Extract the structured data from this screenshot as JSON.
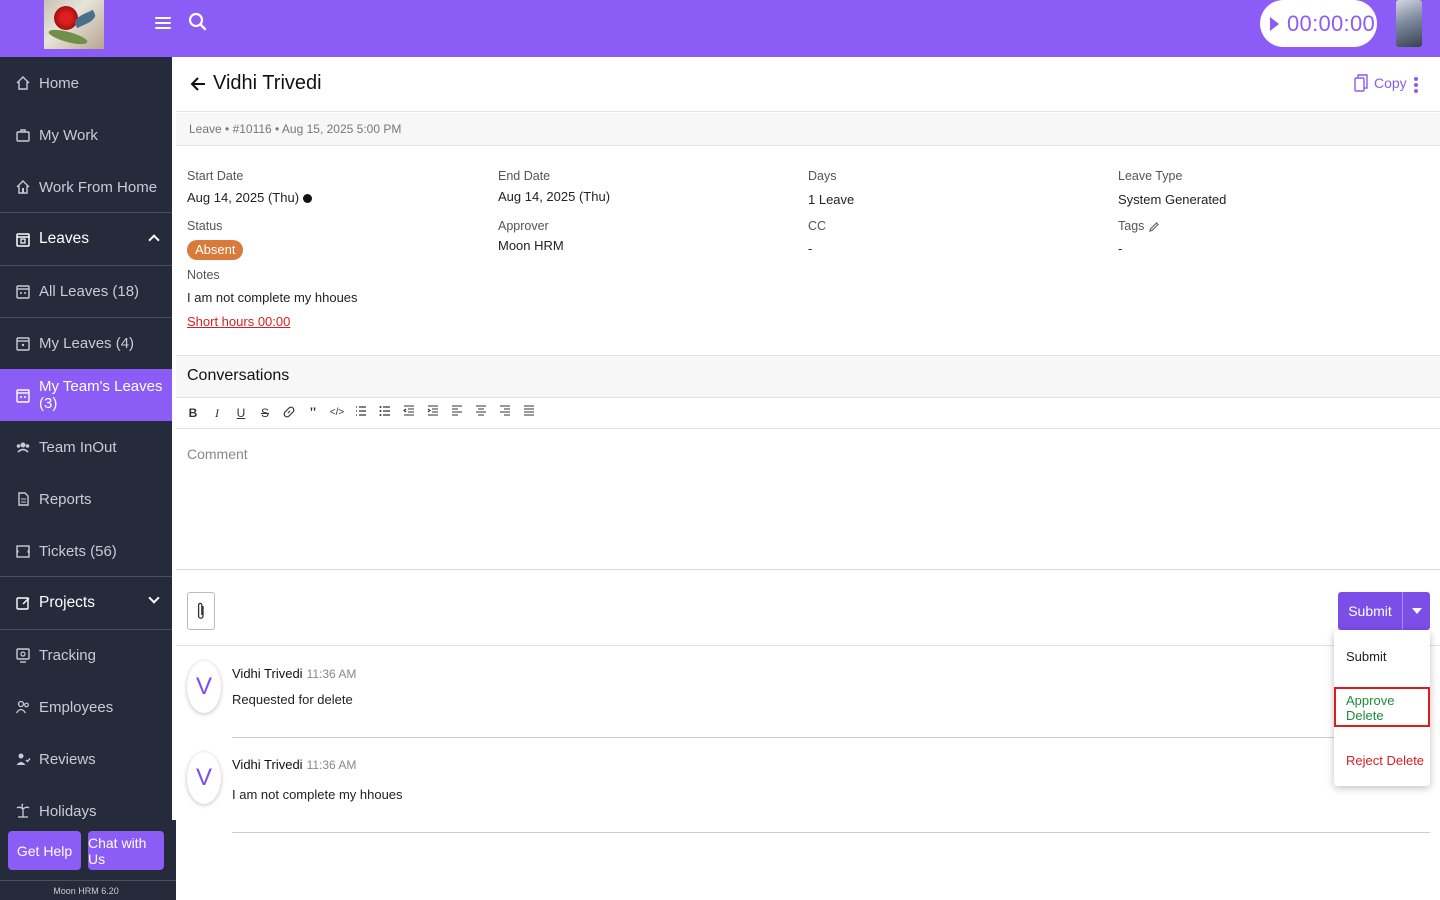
{
  "topbar": {
    "timer": "00:00:00"
  },
  "sidebar": {
    "items": [
      {
        "label": "Home",
        "icon": "home-icon"
      },
      {
        "label": "My Work",
        "icon": "briefcase-icon"
      },
      {
        "label": "Work From Home",
        "icon": "home-icon"
      },
      {
        "label": "Leaves",
        "icon": "calendar-icon"
      },
      {
        "label": "All Leaves (18)",
        "icon": "calendar-icon"
      },
      {
        "label": "My Leaves (4)",
        "icon": "calendar-icon"
      },
      {
        "label": "My Team's Leaves (3)",
        "icon": "calendar-icon"
      },
      {
        "label": "Team InOut",
        "icon": "team-icon"
      },
      {
        "label": "Reports",
        "icon": "report-icon"
      },
      {
        "label": "Tickets (56)",
        "icon": "ticket-icon"
      },
      {
        "label": "Projects",
        "icon": "project-icon"
      },
      {
        "label": "Tracking",
        "icon": "tracking-icon"
      },
      {
        "label": "Employees",
        "icon": "employees-icon"
      },
      {
        "label": "Reviews",
        "icon": "reviews-icon"
      },
      {
        "label": "Holidays",
        "icon": "holidays-icon"
      }
    ],
    "get_help": "Get Help",
    "chat": "Chat with Us",
    "version": "Moon HRM 6.20"
  },
  "header": {
    "title": "Vidhi Trivedi",
    "copy": "Copy"
  },
  "meta": "Leave • #10116 • Aug 15, 2025 5:00 PM",
  "details": {
    "start_date_label": "Start Date",
    "start_date": "Aug 14, 2025 (Thu)",
    "end_date_label": "End Date",
    "end_date": "Aug 14, 2025 (Thu)",
    "days_label": "Days",
    "days": "1 Leave",
    "leave_type_label": "Leave Type",
    "leave_type": "System Generated",
    "status_label": "Status",
    "status": "Absent",
    "approver_label": "Approver",
    "approver": "Moon HRM",
    "cc_label": "CC",
    "cc": "-",
    "tags_label": "Tags",
    "tags": "-",
    "notes_label": "Notes",
    "notes": "I am not complete my hhoues",
    "short_hours": "Short hours 00:00"
  },
  "conversations": {
    "title": "Conversations",
    "placeholder": "Comment",
    "submit": "Submit",
    "menu": [
      "Submit",
      "Approve Delete",
      "Reject Delete"
    ],
    "comments": [
      {
        "initial": "V",
        "name": "Vidhi Trivedi",
        "time": "11:36 AM",
        "text": "Requested for delete"
      },
      {
        "initial": "V",
        "name": "Vidhi Trivedi",
        "time": "11:36 AM",
        "text": "I am not complete my hhoues"
      }
    ]
  },
  "colors": {
    "accent": "#8b5cf6",
    "sidebar": "#262b3b",
    "status_absent": "#d87a3a",
    "approve": "#1f8a3a",
    "reject": "#d61f1f"
  }
}
